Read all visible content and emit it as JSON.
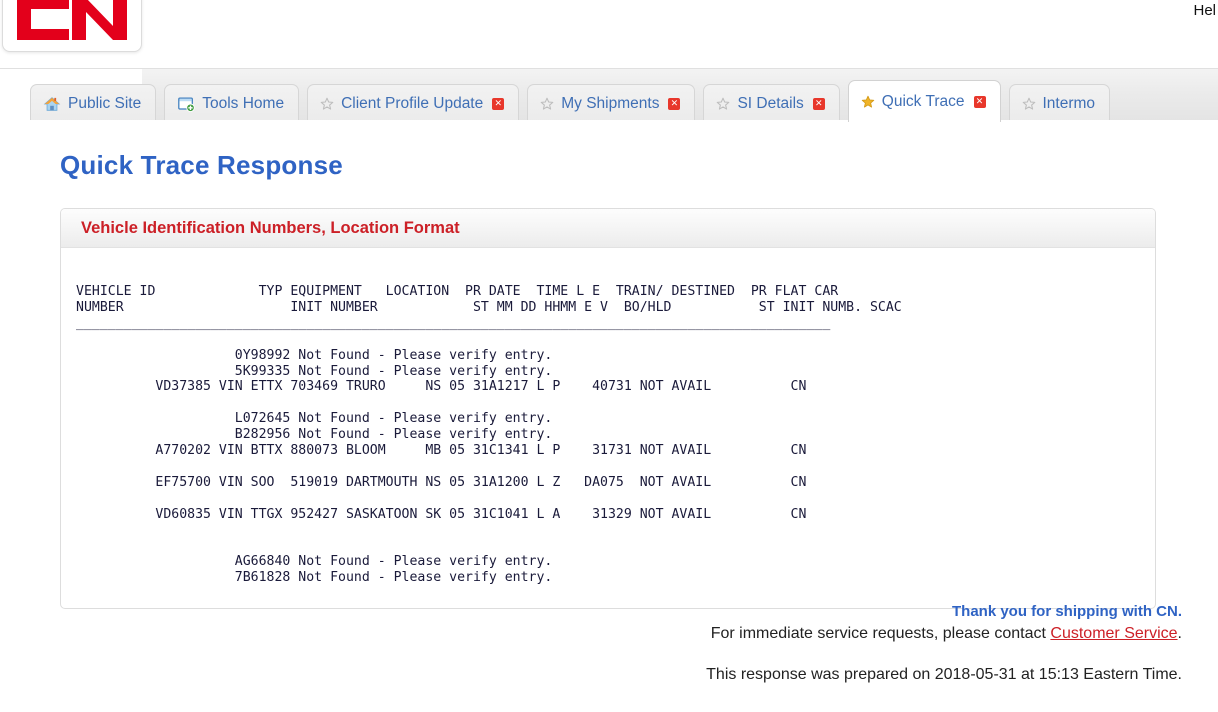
{
  "header": {
    "help_label": "Hel",
    "logo_alt": "CN"
  },
  "tabs": [
    {
      "label": "Public Site",
      "icon": "house-icon",
      "active": false,
      "closable": false,
      "starred": false
    },
    {
      "label": "Tools Home",
      "icon": "window-add-icon",
      "active": false,
      "closable": false,
      "starred": false
    },
    {
      "label": "Client Profile Update",
      "icon": "star-icon",
      "active": false,
      "closable": true,
      "starred": false
    },
    {
      "label": "My Shipments",
      "icon": "star-icon",
      "active": false,
      "closable": true,
      "starred": false
    },
    {
      "label": "SI Details",
      "icon": "star-icon",
      "active": false,
      "closable": true,
      "starred": false
    },
    {
      "label": "Quick Trace",
      "icon": "star-icon",
      "active": true,
      "closable": true,
      "starred": true
    },
    {
      "label": "Intermo",
      "icon": "star-icon",
      "active": false,
      "closable": false,
      "starred": false
    }
  ],
  "page": {
    "title": "Quick Trace Response",
    "panel_title": "Vehicle Identification Numbers, Location Format"
  },
  "report": {
    "header_line_1": "VEHICLE ID             TYP EQUIPMENT   LOCATION  PR DATE  TIME L E  TRAIN/ DESTINED  PR FLAT CAR",
    "header_line_2": "NUMBER                     INIT NUMBER            ST MM DD HHMM E V  BO/HLD           ST INIT NUMB. SCAC",
    "separator": "_______________________________________________________________________________________________",
    "lines": [
      "",
      "                    0Y98992 Not Found - Please verify entry.",
      "                    5K99335 Not Found - Please verify entry.",
      "          VD37385 VIN ETTX 703469 TRURO     NS 05 31A1217 L P    40731 NOT AVAIL          CN",
      "",
      "                    L072645 Not Found - Please verify entry.",
      "                    B282956 Not Found - Please verify entry.",
      "          A770202 VIN BTTX 880073 BLOOM     MB 05 31C1341 L P    31731 NOT AVAIL          CN",
      "",
      "          EF75700 VIN SOO  519019 DARTMOUTH NS 05 31A1200 L Z   DA075  NOT AVAIL          CN",
      "",
      "          VD60835 VIN TTGX 952427 SASKATOON SK 05 31C1041 L A    31329 NOT AVAIL          CN",
      "",
      "",
      "                    AG66840 Not Found - Please verify entry.",
      "                    7B61828 Not Found - Please verify entry."
    ]
  },
  "footer": {
    "thanks": "Thank you for shipping with CN.",
    "service_prefix": "For immediate service requests, please contact ",
    "service_link": "Customer Service",
    "service_suffix": ".",
    "prepared": "This response was prepared on 2018-05-31 at 15:13 Eastern Time."
  },
  "colors": {
    "cn_red": "#cc2027",
    "title_blue": "#2f63c4",
    "tab_blue": "#3f6fb5",
    "link_red": "#cc2027",
    "close_red": "#e8372b",
    "star_gold": "#f0b428"
  }
}
